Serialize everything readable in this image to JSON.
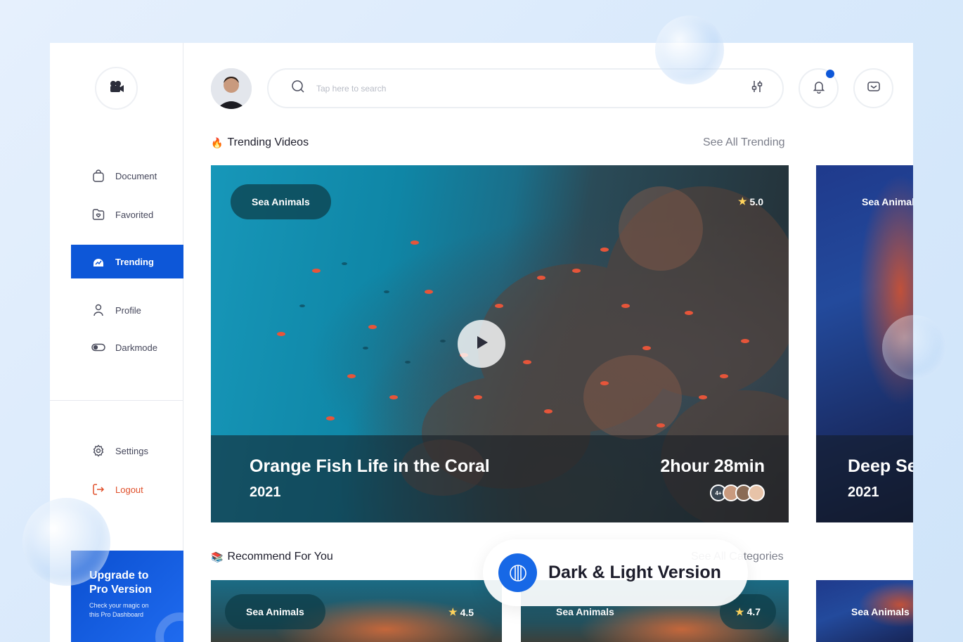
{
  "sidebar": {
    "logo_icon": "video-camera-icon",
    "items": [
      {
        "label": "Document",
        "icon": "bag-icon"
      },
      {
        "label": "Favorited",
        "icon": "folder-heart-icon"
      },
      {
        "label": "Trending",
        "icon": "trending-icon"
      },
      {
        "label": "Profile",
        "icon": "user-icon"
      },
      {
        "label": "Darkmode",
        "icon": "toggle-icon"
      }
    ],
    "bottom_items": [
      {
        "label": "Settings",
        "icon": "gear-icon"
      },
      {
        "label": "Logout",
        "icon": "logout-icon"
      }
    ],
    "upgrade": {
      "title_line1": "Upgrade to",
      "title_line2": "Pro Version",
      "desc_line1": "Check your magic on",
      "desc_line2": "this Pro Dashboard"
    }
  },
  "header": {
    "search": {
      "placeholder": "Tap here to search",
      "value": ""
    }
  },
  "trending": {
    "title": "Trending Videos",
    "emoji": "🔥",
    "see_all": "See All Trending",
    "cards": [
      {
        "tag": "Sea Animals",
        "rating": "5.0",
        "title": "Orange Fish Life in the Coral",
        "year": "2021",
        "duration": "2hour 28min",
        "viewers_more": "4+"
      },
      {
        "tag": "Sea Animals",
        "title": "Deep Se",
        "year": "2021"
      }
    ]
  },
  "recommend": {
    "title": "Recommend For You",
    "emoji": "📚",
    "see_all": "See All Categories",
    "cards": [
      {
        "tag": "Sea Animals",
        "rating": "4.5"
      },
      {
        "tag": "Sea Animals",
        "rating": "4.7"
      },
      {
        "tag": "Sea Animals"
      }
    ]
  },
  "promo": {
    "label": "Dark & Light Version"
  },
  "colors": {
    "accent": "#0d57d8",
    "logout": "#e0502b",
    "star": "#ffd35c"
  }
}
